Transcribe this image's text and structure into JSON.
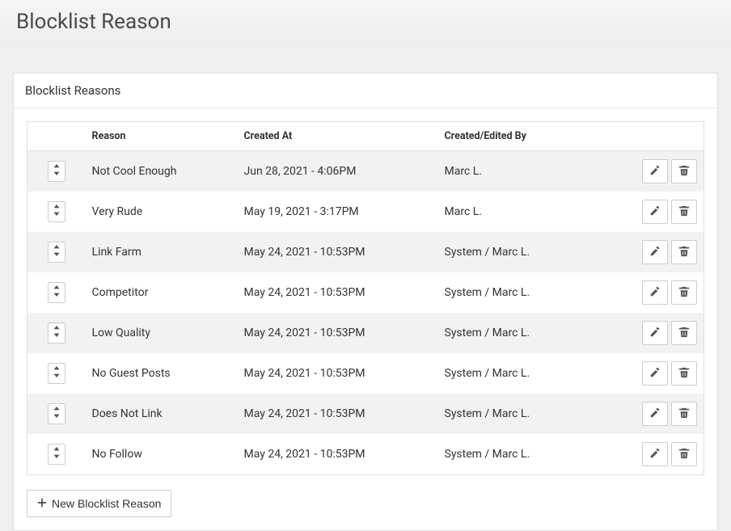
{
  "page": {
    "title": "Blocklist Reason",
    "panel_title": "Blocklist Reasons"
  },
  "table": {
    "headers": {
      "reason": "Reason",
      "created_at": "Created At",
      "created_by": "Created/Edited By"
    },
    "rows": [
      {
        "reason": "Not Cool Enough",
        "created_at": "Jun 28, 2021 - 4:06PM",
        "created_by": "Marc L."
      },
      {
        "reason": "Very Rude",
        "created_at": "May 19, 2021 - 3:17PM",
        "created_by": "Marc L."
      },
      {
        "reason": "Link Farm",
        "created_at": "May 24, 2021 - 10:53PM",
        "created_by": "System / Marc L."
      },
      {
        "reason": "Competitor",
        "created_at": "May 24, 2021 - 10:53PM",
        "created_by": "System / Marc L."
      },
      {
        "reason": "Low Quality",
        "created_at": "May 24, 2021 - 10:53PM",
        "created_by": "System / Marc L."
      },
      {
        "reason": "No Guest Posts",
        "created_at": "May 24, 2021 - 10:53PM",
        "created_by": "System / Marc L."
      },
      {
        "reason": "Does Not Link",
        "created_at": "May 24, 2021 - 10:53PM",
        "created_by": "System / Marc L."
      },
      {
        "reason": "No Follow",
        "created_at": "May 24, 2021 - 10:53PM",
        "created_by": "System / Marc L."
      }
    ]
  },
  "buttons": {
    "new_reason": "New Blocklist Reason"
  }
}
